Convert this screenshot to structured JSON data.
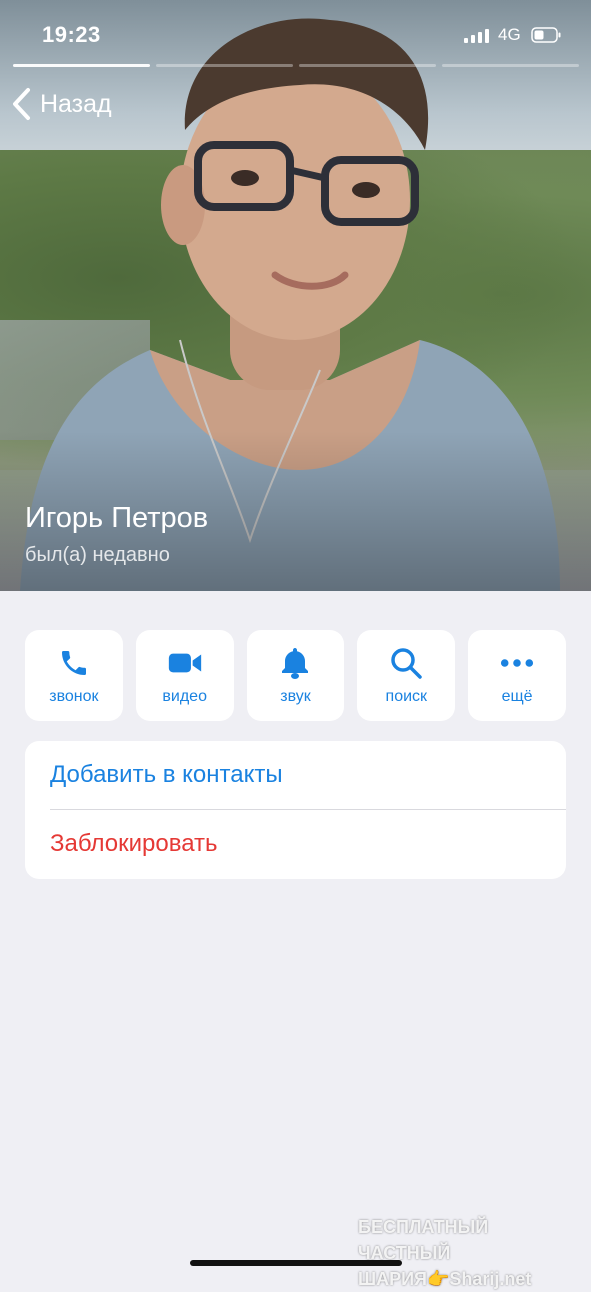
{
  "status_bar": {
    "time": "19:23",
    "network": "4G"
  },
  "navigation": {
    "back_label": "Назад"
  },
  "profile": {
    "name": "Игорь Петров",
    "last_seen": "был(а) недавно",
    "photo_count": 4,
    "active_photo": 1
  },
  "actions": [
    {
      "label": "звонок",
      "icon": "phone-icon"
    },
    {
      "label": "видео",
      "icon": "video-camera-icon"
    },
    {
      "label": "звук",
      "icon": "bell-icon"
    },
    {
      "label": "поиск",
      "icon": "search-icon"
    },
    {
      "label": "ещё",
      "icon": "more-dots-icon"
    }
  ],
  "menu": {
    "add_contact": "Добавить в контакты",
    "block": "Заблокировать"
  },
  "watermark": {
    "line1": "БЕСПЛАТНЫЙ ЧАСТНЫЙ",
    "line2": "ШАРИЯ👉Sharij.net"
  },
  "colors": {
    "accent": "#1a82e0",
    "danger": "#e53935",
    "background": "#efeff4"
  }
}
